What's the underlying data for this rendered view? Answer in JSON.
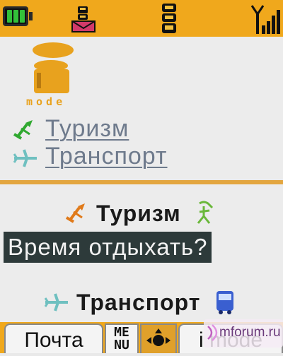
{
  "status_bar": {
    "battery_icon": "battery-full-icon",
    "mail_icon": "mail-icon",
    "imode_icon": "imode-icon",
    "signal_icon": "signal-strength-icon",
    "battery_level": 1.0,
    "signal_level": 1.0
  },
  "logo": {
    "text": "mode",
    "icon": "imode-logo-icon"
  },
  "links": [
    {
      "label": "Туризм",
      "icon": "tourism-icon"
    },
    {
      "label": "Транспорт",
      "icon": "airplane-icon"
    }
  ],
  "sections": {
    "tourism": {
      "title": "Туризм",
      "icon_left": "tourism-icon",
      "icon_right": "hiker-icon",
      "highlight": "Время отдыхать?"
    },
    "transport": {
      "title": "Транспорт",
      "icon_left": "airplane-icon",
      "icon_right": "bus-icon"
    }
  },
  "softkeys": {
    "left": "Почта",
    "menu": "MENU",
    "right": "i mode"
  },
  "watermark": "mforum.ru",
  "colors": {
    "bar": "#f0a81c",
    "divider": "#e3a640",
    "link": "#6e7a8c",
    "highlight_bg": "#2d3a3a"
  }
}
